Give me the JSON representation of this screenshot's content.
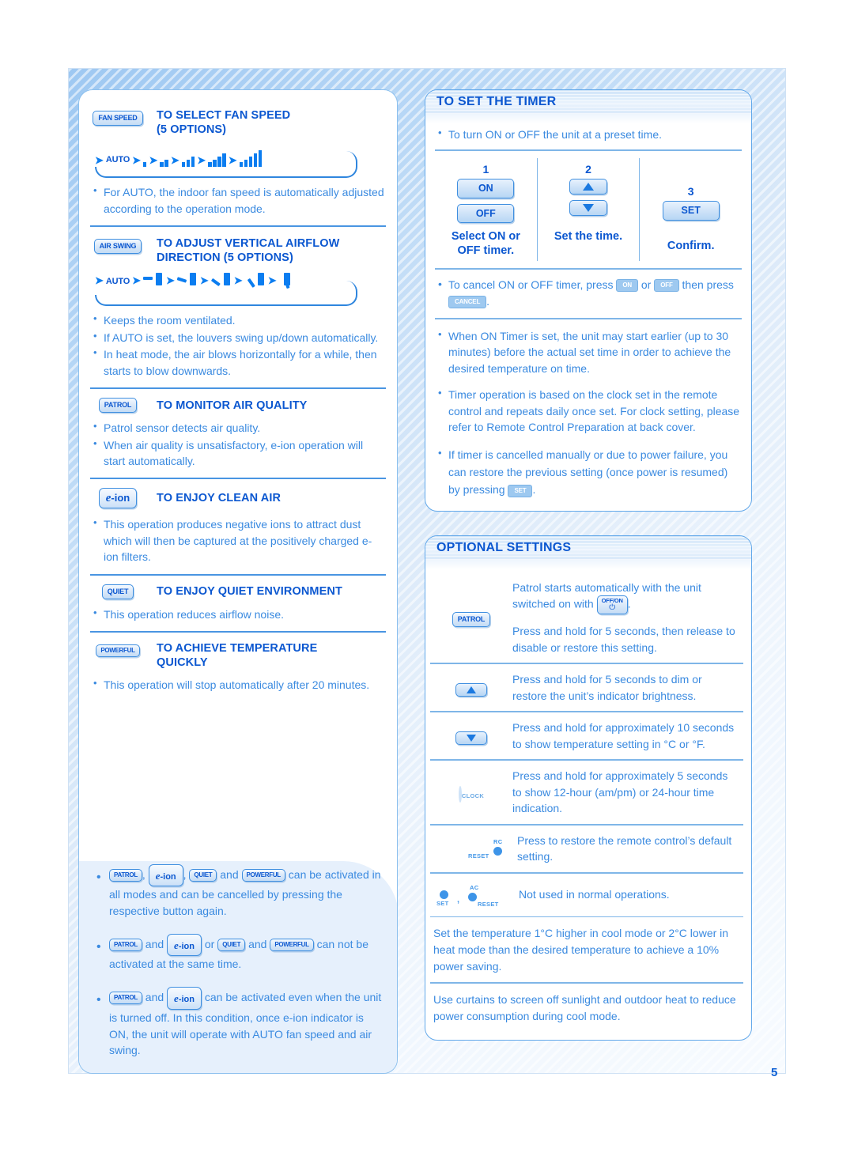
{
  "page": {
    "number": "5"
  },
  "left": {
    "fan_speed": {
      "chip": "FAN SPEED",
      "title_line1": "TO SELECT FAN SPEED",
      "title_line2": "(5 OPTIONS)",
      "sequence_label": "AUTO",
      "sequence_steps": [
        1,
        2,
        3,
        4,
        5
      ],
      "bullets": [
        "For AUTO, the indoor fan speed is automatically adjusted according to the operation mode."
      ]
    },
    "air_swing": {
      "chip": "AIR SWING",
      "title_line1": "TO ADJUST VERTICAL AIRFLOW",
      "title_line2": "DIRECTION  (5 OPTIONS)",
      "sequence_label": "AUTO",
      "sequence_steps": [
        1,
        2,
        3,
        4,
        5
      ],
      "bullets": [
        "Keeps the room ventilated.",
        "If AUTO is set, the louvers swing up/down automatically.",
        "In heat mode, the air blows horizontally for a while, then starts to blow downwards."
      ]
    },
    "patrol": {
      "chip": "PATROL",
      "title": "TO MONITOR AIR QUALITY",
      "bullets": [
        "Patrol sensor detects air quality.",
        "When air quality is unsatisfactory, e-ion operation will start automatically."
      ]
    },
    "eion": {
      "chip_e": "e",
      "chip_ion": "-ion",
      "title": "TO ENJOY CLEAN AIR",
      "bullets": [
        "This operation produces negative ions to attract dust which will then be captured at the positively charged e-ion filters."
      ]
    },
    "quiet": {
      "chip": "QUIET",
      "title": "TO ENJOY QUIET ENVIRONMENT",
      "bullets": [
        "This operation reduces airflow noise."
      ]
    },
    "powerful": {
      "chip": "POWERFUL",
      "title_line1": "TO ACHIEVE TEMPERATURE",
      "title_line2": "QUICKLY",
      "bullets": [
        "This operation will stop automatically after 20 minutes."
      ]
    },
    "notes": {
      "note1": {
        "chip_patrol": "PATROL",
        "chip_quiet": "QUIET",
        "chip_powerful": "POWERFUL",
        "and_label": "and",
        "comma1": ",",
        "comma2": ",",
        "text": "can be activated in all modes and can be cancelled by pressing the respective button again."
      },
      "note2": {
        "chip_patrol": "PATROL",
        "chip_quiet": "QUIET",
        "chip_powerful": "POWERFUL",
        "and1": "and",
        "or1": "or",
        "and2": "and",
        "text": "can not be activated at the same time."
      },
      "note3": {
        "chip_patrol": "PATROL",
        "and1": "and",
        "text": "can be activated even when the unit is turned off. In this condition, once e-ion indicator is ON, the unit will operate with AUTO fan speed and air swing."
      }
    }
  },
  "right": {
    "timer": {
      "heading": "TO SET THE TIMER",
      "intro": "To turn ON or OFF the unit at a preset time.",
      "steps": [
        {
          "num": "1",
          "btn_on": "ON",
          "btn_off": "OFF",
          "caption_line1": "Select ON or",
          "caption_line2": "OFF timer."
        },
        {
          "num": "2",
          "caption_line1": "Set the time.",
          "caption_line2": ""
        },
        {
          "num": "3",
          "btn_set": "SET",
          "caption_line1": "Confirm.",
          "caption_line2": ""
        }
      ],
      "cancel_line": {
        "pre": "To cancel ON or OFF timer, press",
        "chip_on": "ON",
        "or": "or",
        "chip_off": "OFF",
        "mid": "then",
        "press": "press",
        "chip_cancel": "CANCEL",
        "period": "."
      },
      "bullets": [
        "When ON Timer is set, the unit may start earlier (up to 30 minutes) before the actual set time in order to achieve the desired temperature on time.",
        "Timer operation is based on the clock set in the remote control and repeats daily once set. For clock setting, please refer to Remote Control Preparation at back cover."
      ],
      "restore_line": {
        "pre": "If timer is cancelled manually or due to power failure, you can restore the previous setting (once power is resumed) by pressing",
        "chip_set": "SET",
        "period": "."
      }
    },
    "optional": {
      "heading": "OPTIONAL SETTINGS",
      "rows": [
        {
          "icon": "patrol-chip",
          "chip": "PATROL",
          "text_pre": "Patrol starts automatically with the unit switched on with",
          "chip_offon_top": "OFF/ON",
          "chip_offon_power": "⏻",
          "text_post": ".",
          "text2": "Press and hold for 5 seconds, then release to disable or restore this setting."
        },
        {
          "icon": "up-arrow-button",
          "text": "Press and hold for 5 seconds to dim or restore the unit’s indicator brightness."
        },
        {
          "icon": "down-arrow-button",
          "text": "Press and hold for approximately 10 seconds to show temperature setting in °C or °F."
        },
        {
          "icon": "clock-button",
          "icon_label": "CLOCK",
          "text": "Press and hold for approximately 5 seconds to show 12-hour (am/pm) or 24-hour time indication."
        },
        {
          "icon": "rc-reset-button",
          "icon_label_top": "RC",
          "icon_label_bottom": "RESET",
          "text": "Press to restore the remote control’s default setting."
        },
        {
          "icon": "set-ac-reset-buttons",
          "icon_label_set": "SET",
          "icon_label_ac": "AC",
          "icon_label_reset": "RESET",
          "separator": ",",
          "text": "Not used in normal operations."
        }
      ],
      "tips": [
        "Set the temperature 1°C higher in cool mode or 2°C lower in heat mode than the desired temperature to achieve a 10% power saving.",
        "Use curtains to screen off sunlight and outdoor heat to reduce power consumption during cool mode."
      ]
    }
  }
}
